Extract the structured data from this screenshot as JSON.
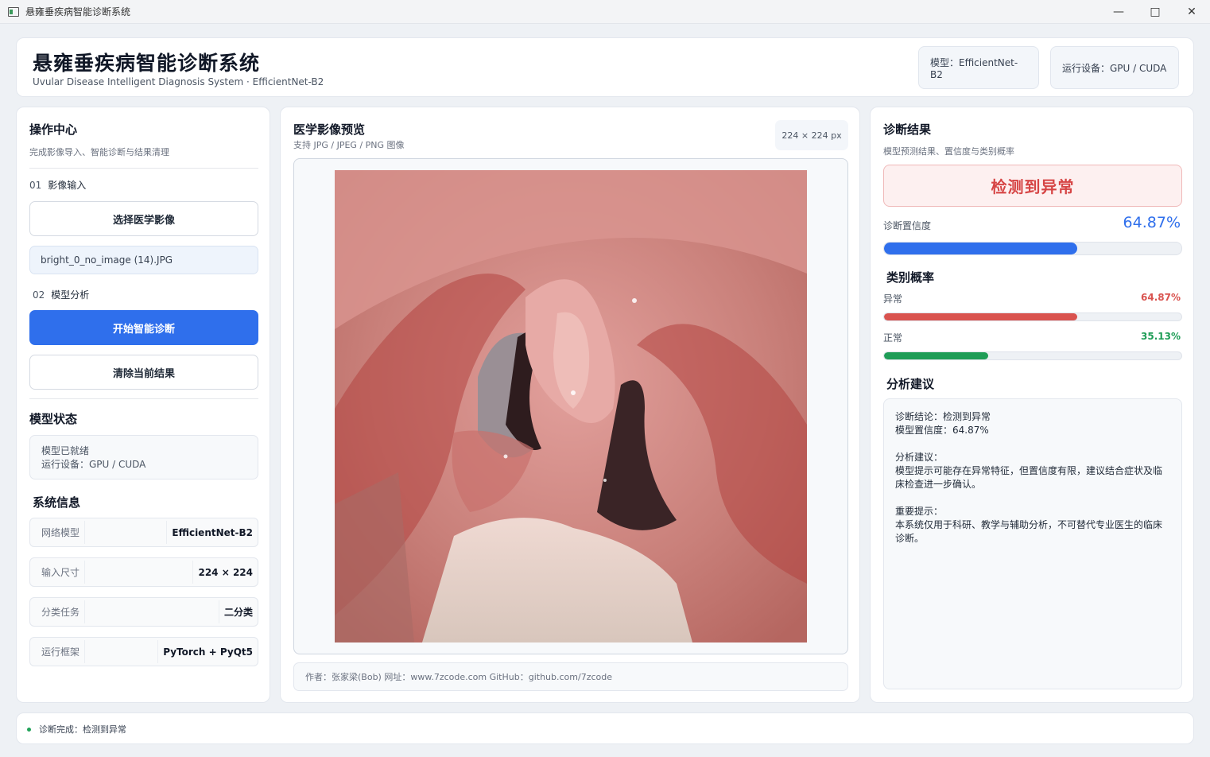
{
  "window": {
    "title": "悬雍垂疾病智能诊断系统"
  },
  "header": {
    "title": "悬雍垂疾病智能诊断系统",
    "subtitle": "Uvular Disease Intelligent Diagnosis System · EfficientNet-B2",
    "model_pill": "模型：EfficientNet-B2",
    "device_pill": "运行设备：GPU / CUDA"
  },
  "left": {
    "title": "操作中心",
    "subtitle": "完成影像导入、智能诊断与结果清理",
    "step1_num": "01",
    "step1_label": "影像输入",
    "select_button": "选择医学影像",
    "file_name": "bright_0_no_image (14).JPG",
    "step2_num": "02",
    "step2_label": "模型分析",
    "start_button": "开始智能诊断",
    "clear_button": "清除当前结果",
    "model_status_title": "模型状态",
    "model_status_line1": "模型已就绪",
    "model_status_line2": "运行设备：GPU / CUDA",
    "sysinfo_title": "系统信息",
    "sysinfo": [
      {
        "key": "网络模型",
        "value": "EfficientNet-B2"
      },
      {
        "key": "输入尺寸",
        "value": "224 × 224"
      },
      {
        "key": "分类任务",
        "value": "二分类"
      },
      {
        "key": "运行框架",
        "value": "PyTorch + PyQt5"
      }
    ]
  },
  "center": {
    "title": "医学影像预览",
    "subtitle": "支持 JPG / JPEG / PNG 图像",
    "size_badge": "224 × 224 px",
    "footer": "作者：张家梁(Bob)  网址：www.7zcode.com GitHub：github.com/7zcode"
  },
  "right": {
    "title": "诊断结果",
    "subtitle": "模型预测结果、置信度与类别概率",
    "result": "检测到异常",
    "confidence_label": "诊断置信度",
    "confidence_value": "64.87%",
    "confidence_fraction": 0.6487,
    "class_title": "类别概率",
    "classes": [
      {
        "label": "异常",
        "value": "64.87%",
        "fraction": 0.6487,
        "color": "#d9534f"
      },
      {
        "label": "正常",
        "value": "35.13%",
        "fraction": 0.3513,
        "color": "#1f9d57"
      }
    ],
    "advice_title": "分析建议",
    "advice_text": "诊断结论：检测到异常\n模型置信度：64.87%\n\n分析建议：\n模型提示可能存在异常特征，但置信度有限，建议结合症状及临床检查进一步确认。\n\n重要提示：\n本系统仅用于科研、教学与辅助分析，不可替代专业医生的临床诊断。"
  },
  "statusbar": {
    "text": "诊断完成：检测到异常"
  },
  "colors": {
    "primary": "#2f6fec",
    "danger": "#d64545",
    "success": "#1f9d57"
  }
}
